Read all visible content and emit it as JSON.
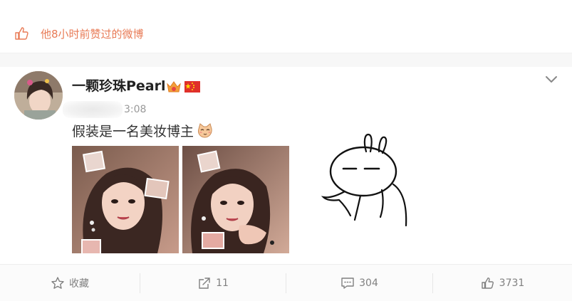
{
  "liked_banner": {
    "text": "他8小时前赞过的微博",
    "icon": "thumbs-up-icon",
    "color": "#e87a55"
  },
  "post": {
    "author": {
      "name": "一颗珍珠Pearl",
      "avatar": "avatar-photo",
      "badges": [
        "vip-crown-icon",
        "china-flag-icon"
      ]
    },
    "timestamp": "3:08",
    "text": "假装是一名美妆博主",
    "emoji": "cat-face-emoji",
    "menu_icon": "chevron-down-icon",
    "photos": [
      "selfie-photo-1",
      "selfie-photo-2"
    ]
  },
  "actions": {
    "favorite": {
      "icon": "star-icon",
      "label": "收藏"
    },
    "repost": {
      "icon": "share-icon",
      "count": "11"
    },
    "comment": {
      "icon": "comment-icon",
      "count": "304"
    },
    "like": {
      "icon": "thumbs-up-icon",
      "count": "3731"
    }
  },
  "colors": {
    "accent_orange": "#e87a55",
    "text_dark": "#222222",
    "text_gray": "#808080"
  }
}
